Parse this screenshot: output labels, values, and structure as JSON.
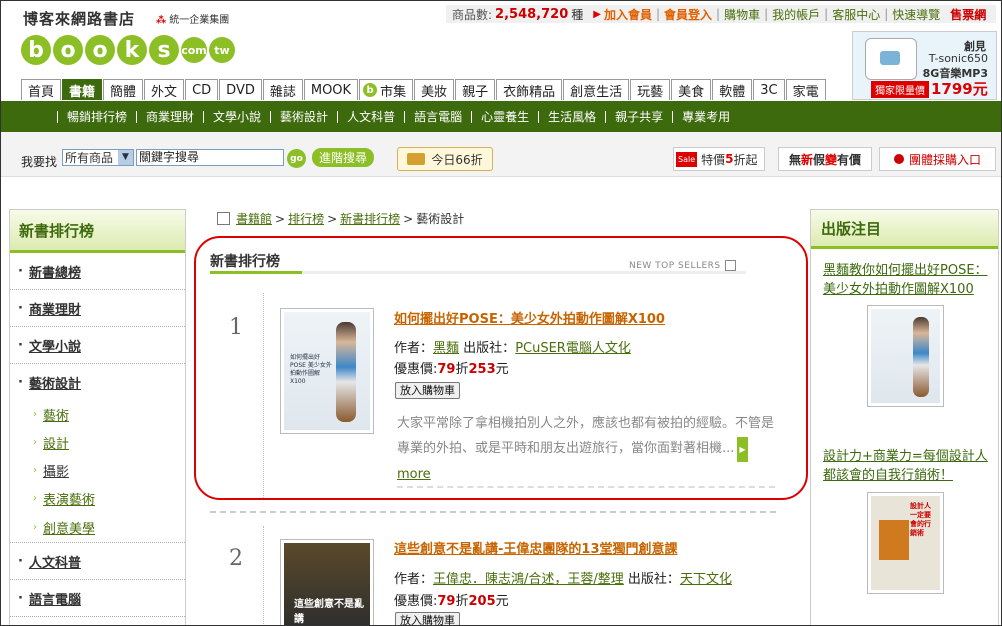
{
  "header": {
    "logo_cn": "博客來網路書店",
    "logo_sub": "統一企業集團",
    "logo_letters": [
      "b",
      "o",
      "o",
      "k",
      "s"
    ],
    "logo_com": "com",
    "logo_tw": "tw",
    "product_count_label": "商品數:",
    "product_count": "2,548,720",
    "product_count_unit": "種",
    "join": "加入會員",
    "login": "會員登入",
    "links": [
      "購物車",
      "我的帳戶",
      "客服中心",
      "快速導覽"
    ],
    "store": "售票網"
  },
  "ad": {
    "brand": "創見",
    "model": "T-sonic650",
    "model2": "8G音樂MP3",
    "tag": "獨家限量價",
    "price": "1799元"
  },
  "tabs": [
    "首頁",
    "書籍",
    "簡體",
    "外文",
    "CD",
    "DVD",
    "雜誌",
    "MOOK",
    "市集",
    "美妝",
    "親子",
    "衣飾精品",
    "創意生活",
    "玩藝",
    "美食",
    "軟體",
    "3C",
    "家電"
  ],
  "tabs_active_index": 1,
  "bshop_icon": "b",
  "subnav": [
    "暢銷排行榜",
    "商業理財",
    "文學小說",
    "藝術設計",
    "人文科普",
    "語言電腦",
    "心靈養生",
    "生活風格",
    "親子共享",
    "專業考用"
  ],
  "search": {
    "label": "我要找",
    "select_value": "所有商品",
    "input_value": "關鍵字搜尋",
    "go": "go",
    "advanced": "進階搜尋",
    "today": "今日66折",
    "sale_tag": "Sale",
    "sale_pre": "特價",
    "sale_num": "5",
    "sale_post": "折起",
    "fake_1": "無",
    "fake_2": "新",
    "fake_3": "假",
    "fake_4": "變",
    "fake_5": "有價",
    "group": "團體採購入口"
  },
  "left": {
    "title": "新書排行榜",
    "categories": [
      {
        "label": "新書總榜"
      },
      {
        "label": "商業理財"
      },
      {
        "label": "文學小說"
      },
      {
        "label": "藝術設計"
      }
    ],
    "subs": [
      {
        "label": "藝術"
      },
      {
        "label": "設計"
      },
      {
        "label": "攝影"
      },
      {
        "label": "表演藝術"
      },
      {
        "label": "創意美學"
      }
    ],
    "categories2": [
      {
        "label": "人文科普"
      },
      {
        "label": "語言電腦"
      }
    ]
  },
  "breadcrumb": {
    "items": [
      "書籍館",
      "排行榜",
      "新書排行榜"
    ],
    "current": "藝術設計",
    "sep": ">"
  },
  "section": {
    "title": "新書排行榜",
    "en": "NEW TOP SELLERS"
  },
  "books": [
    {
      "rank": "1",
      "title": "如何擺出好POSE：美少女外拍動作圖解X100",
      "author_label": "作者：",
      "author": "黑麵",
      "publisher_label": "出版社：",
      "publisher": "PCuSER電腦人文化",
      "price_label": "優惠價:",
      "discount": "79",
      "discount_unit": "折",
      "price": "253",
      "price_unit": "元",
      "cart": "放入購物車",
      "desc": "大家平常除了拿相機拍別人之外，應該也都有被拍的經驗。不管是專業的外拍、或是平時和朋友出遊旅行，當你面對著相機",
      "ellipsis": "...",
      "more": "more",
      "cover_text": "如何擺出好POSE 美少女外拍動作圖解X100"
    },
    {
      "rank": "2",
      "title": "這些創意不是亂講-王偉忠團隊的13堂獨門創意課",
      "author_label": "作者：",
      "author": "王偉忠．陳志鴻/合述，王蓉/整理",
      "publisher_label": "出版社：",
      "publisher": "天下文化",
      "price_label": "優惠價:",
      "discount": "79",
      "discount_unit": "折",
      "price": "205",
      "price_unit": "元",
      "cart": "放入購物車",
      "cover_text": "這些創意不是亂講"
    }
  ],
  "right": {
    "title": "出版注目",
    "items": [
      {
        "title": "黑麵教你如何擺出好POSE：美少女外拍動作圖解X100"
      },
      {
        "title": "設計力+商業力=每個設計人都該會的自我行銷術！",
        "cover_text": "設計人一定要會的行銷術"
      }
    ]
  }
}
